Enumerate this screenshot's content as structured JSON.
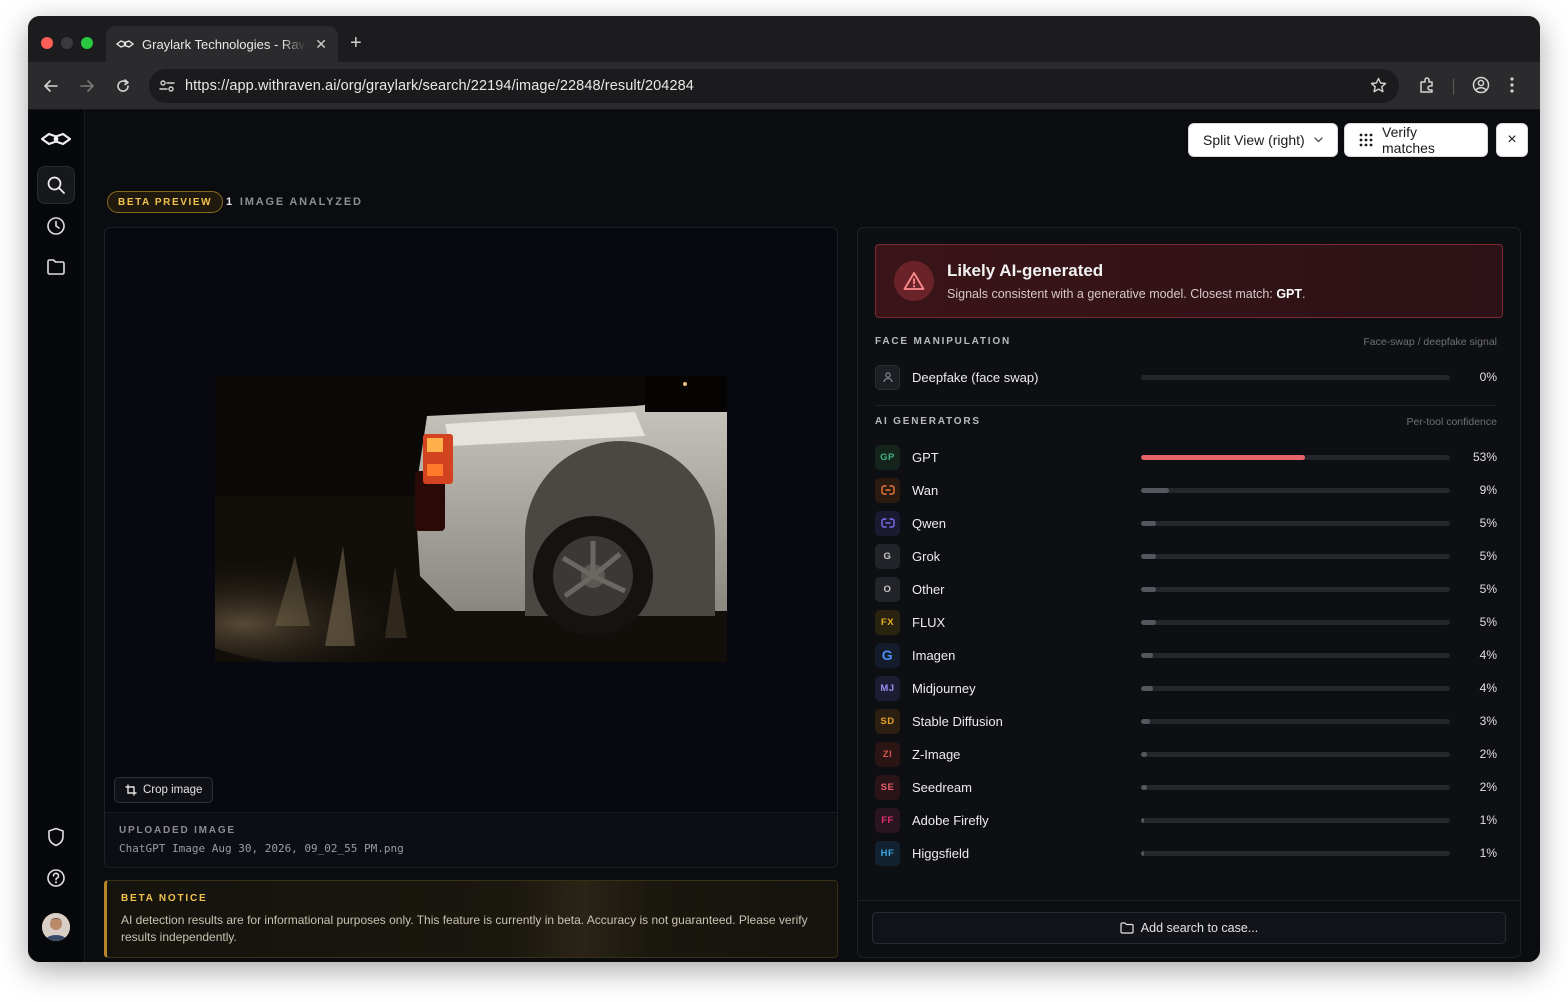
{
  "browser": {
    "tab_title": "Graylark Technologies - Raven",
    "url": "https://app.withraven.ai/org/graylark/search/22194/image/22848/result/204284"
  },
  "rail": {
    "items": [
      "logo-icon",
      "search-icon",
      "history-icon",
      "folder-icon"
    ],
    "bottom": [
      "shield-icon",
      "help-icon",
      "avatar"
    ]
  },
  "header": {
    "split_view_label": "Split View (right)",
    "verify_label": "Verify matches",
    "close_label": "×"
  },
  "status": {
    "beta_label": "BETA PREVIEW",
    "count": "1",
    "analyzed_label": "IMAGE ANALYZED"
  },
  "image_panel": {
    "crop_label": "Crop image",
    "uploaded_label": "UPLOADED IMAGE",
    "filename": "ChatGPT Image Aug 30, 2026, 09_02_55 PM.png"
  },
  "notice": {
    "title": "BETA NOTICE",
    "text": "AI detection results are for informational purposes only. This feature is currently in beta. Accuracy is not guaranteed. Please verify results independently."
  },
  "verdict": {
    "title": "Likely AI-generated",
    "subtitle_prefix": "Signals consistent with a generative model. Closest match: ",
    "match": "GPT",
    "subtitle_suffix": "."
  },
  "face_manipulation": {
    "title": "FACE MANIPULATION",
    "note": "Face-swap / deepfake signal",
    "items": [
      {
        "name": "Deepfake (face swap)",
        "value": 0,
        "pct": "0%"
      }
    ]
  },
  "ai_generators": {
    "title": "AI GENERATORS",
    "note": "Per-tool confidence",
    "items": [
      {
        "abbr": "GP",
        "name": "GPT",
        "value": 53,
        "pct": "53%",
        "color": "#3fb27f",
        "bg": "#14241c"
      },
      {
        "abbr": "",
        "name": "Wan",
        "value": 9,
        "pct": "9%",
        "color": "#e8793a",
        "bg": "#2a1a10"
      },
      {
        "abbr": "",
        "name": "Qwen",
        "value": 5,
        "pct": "5%",
        "color": "#7b6cf0",
        "bg": "#1b1a33"
      },
      {
        "abbr": "G",
        "name": "Grok",
        "value": 5,
        "pct": "5%",
        "color": "#c8c8c8",
        "bg": "#22242a"
      },
      {
        "abbr": "O",
        "name": "Other",
        "value": 5,
        "pct": "5%",
        "color": "#c8c8c8",
        "bg": "#22242a"
      },
      {
        "abbr": "FX",
        "name": "FLUX",
        "value": 5,
        "pct": "5%",
        "color": "#e6b325",
        "bg": "#2a2310"
      },
      {
        "abbr": "G",
        "name": "Imagen",
        "value": 4,
        "pct": "4%",
        "color": "#4c8df6",
        "bg": "#141c2c"
      },
      {
        "abbr": "MJ",
        "name": "Midjourney",
        "value": 4,
        "pct": "4%",
        "color": "#9a8cf0",
        "bg": "#1e1c33"
      },
      {
        "abbr": "SD",
        "name": "Stable Diffusion",
        "value": 3,
        "pct": "3%",
        "color": "#e6a025",
        "bg": "#2a1f10"
      },
      {
        "abbr": "ZI",
        "name": "Z-Image",
        "value": 2,
        "pct": "2%",
        "color": "#d9534f",
        "bg": "#2a1414"
      },
      {
        "abbr": "SE",
        "name": "Seedream",
        "value": 2,
        "pct": "2%",
        "color": "#e65c6a",
        "bg": "#2a1418"
      },
      {
        "abbr": "FF",
        "name": "Adobe Firefly",
        "value": 1,
        "pct": "1%",
        "color": "#e0336b",
        "bg": "#2a1420"
      },
      {
        "abbr": "HF",
        "name": "Higgsfield",
        "value": 1,
        "pct": "1%",
        "color": "#3aa7e0",
        "bg": "#122230"
      }
    ]
  },
  "footer": {
    "case_label": "Add search to case..."
  }
}
